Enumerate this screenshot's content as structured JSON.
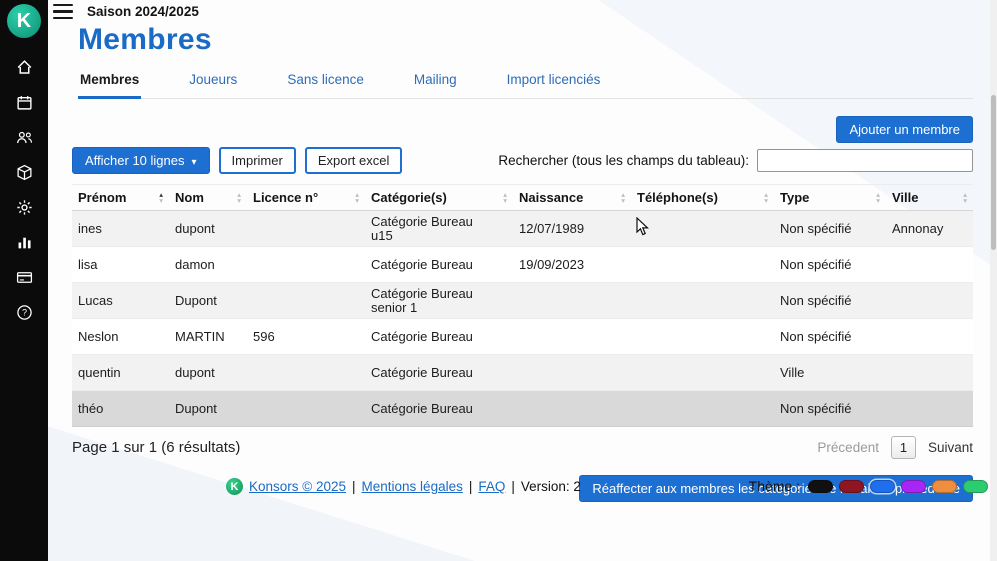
{
  "colors": {
    "accent": "#1a6bc5",
    "button_blue": "#1d6fd2",
    "sidebar_bg": "#0b0b0b",
    "row_stripe": "#f2f2f2",
    "row_hover": "#d9d9d9",
    "logo_teal": "#16a58a"
  },
  "sidebar": {
    "icons": [
      "home",
      "calendar",
      "members",
      "equipment",
      "settings",
      "stats",
      "billing",
      "help"
    ]
  },
  "topbar": {
    "season": "Saison 2024/2025"
  },
  "page": {
    "title": "Membres"
  },
  "tabs": [
    {
      "label": "Membres",
      "active": true
    },
    {
      "label": "Joueurs",
      "active": false
    },
    {
      "label": "Sans licence",
      "active": false
    },
    {
      "label": "Mailing",
      "active": false
    },
    {
      "label": "Import licenciés",
      "active": false
    }
  ],
  "toolbar": {
    "show_lines_label": "Afficher 10 lignes",
    "print_label": "Imprimer",
    "export_label": "Export excel",
    "add_member_label": "Ajouter un membre",
    "search_label": "Rechercher (tous les champs du tableau):",
    "search_value": ""
  },
  "table": {
    "columns": [
      "Prénom",
      "Nom",
      "Licence n°",
      "Catégorie(s)",
      "Naissance",
      "Téléphone(s)",
      "Type",
      "Ville"
    ],
    "rows": [
      [
        "ines",
        "dupont",
        "",
        "Catégorie Bureau\nu15",
        "12/07/1989",
        "",
        "Non spécifié",
        "Annonay"
      ],
      [
        "lisa",
        "damon",
        "",
        "Catégorie Bureau",
        "19/09/2023",
        "",
        "Non spécifié",
        ""
      ],
      [
        "Lucas",
        "Dupont",
        "",
        "Catégorie Bureau\nsenior 1",
        "",
        "",
        "Non spécifié",
        ""
      ],
      [
        "Neslon",
        "MARTIN",
        "596",
        "Catégorie Bureau",
        "",
        "",
        "Non spécifié",
        ""
      ],
      [
        "quentin",
        "dupont",
        "",
        "Catégorie Bureau",
        "",
        "",
        "Ville",
        ""
      ],
      [
        "théo",
        "Dupont",
        "",
        "Catégorie Bureau",
        "",
        "",
        "Non spécifié",
        ""
      ]
    ]
  },
  "pagination": {
    "summary": "Page 1 sur 1 (6 résultats)",
    "previous_label": "Précedent",
    "current_page": "1",
    "next_label": "Suivant"
  },
  "actions": {
    "reassign_label": "Réaffecter aux membres les catégories de la saison précédente"
  },
  "footer": {
    "brand": "Konsors © 2025",
    "separator": "|",
    "legal": "Mentions légales",
    "faq": "FAQ",
    "version": "Version: 2",
    "theme_label": "Thème :",
    "theme_colors": [
      "#111111",
      "#8e1522",
      "#1e6ff0",
      "#a826f5",
      "#ef8e3e",
      "#2ecc71"
    ]
  }
}
